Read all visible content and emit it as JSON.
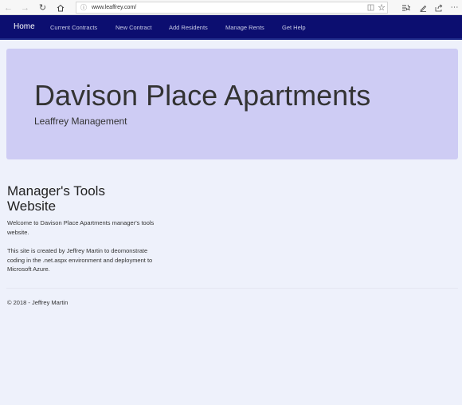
{
  "browser": {
    "url": "www.leaffrey.com/"
  },
  "navbar": {
    "brand": "Home",
    "links": [
      "Current Contracts",
      "New Contract",
      "Add Residents",
      "Manage Rents",
      "Get Help"
    ]
  },
  "jumbotron": {
    "title": "Davison Place Apartments",
    "subtitle": "Leaffrey Management"
  },
  "main": {
    "heading": "Manager's Tools Website",
    "paragraph1": "Welcome to Davison Place Apartments manager's tools website.",
    "paragraph2": "This site is created by Jeffrey Martin to deomonstrate coding in the .net.aspx environment and deployment to Microsoft Azure."
  },
  "footer": {
    "text": "© 2018 - Jeffrey Martin"
  }
}
